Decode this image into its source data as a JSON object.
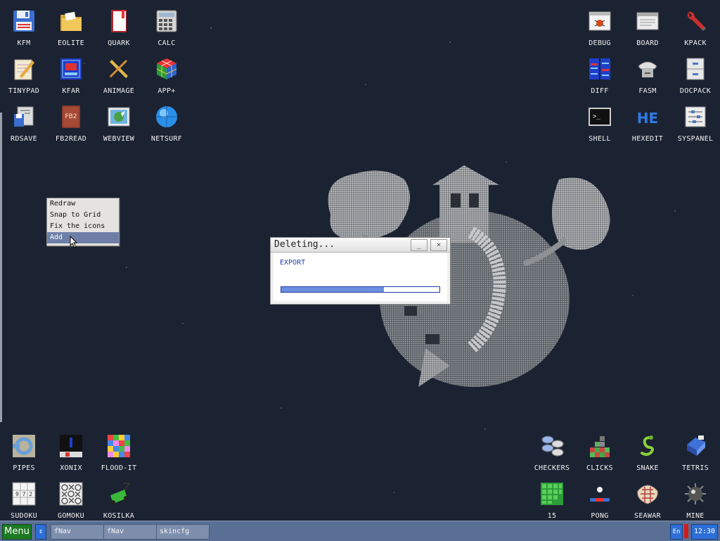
{
  "desktop": {
    "icons": {
      "kfm": "KFM",
      "eolite": "EOLITE",
      "quark": "QUARK",
      "calc": "CALC",
      "tinypad": "TINYPAD",
      "kfar": "KFAR",
      "animage": "ANIMAGE",
      "app_plus": "APP+",
      "rdsave": "RDSAVE",
      "fb2read": "FB2READ",
      "webview": "WEBVIEW",
      "netsurf": "NETSURF",
      "debug": "DEBUG",
      "board": "BOARD",
      "kpack": "KPACK",
      "diff": "DIFF",
      "fasm": "FASM",
      "docpack": "DOCPACK",
      "shell": "SHELL",
      "hexedit": "HEXEDIT",
      "syspanel": "SYSPANEL",
      "pipes": "PIPES",
      "xonix": "XONIX",
      "flood_it": "FLOOD-IT",
      "sudoku": "SUDOKU",
      "gomoku": "GOMOKU",
      "kosilka": "KOSILKA",
      "checkers": "CHECKERS",
      "clicks": "CLICKS",
      "snake": "SNAKE",
      "tetris": "TETRIS",
      "fifteen": "15",
      "pong": "PONG",
      "seawar": "SEAWAR",
      "mine": "MINE"
    },
    "fb2_glyph": "FB2",
    "he_glyph": "HE",
    "shell_glyph": ">_",
    "sudoku_glyph": "9 7 2"
  },
  "context_menu": {
    "items": [
      "Redraw",
      "Snap to Grid",
      "Fix the icons",
      "Add"
    ],
    "selected": "Add"
  },
  "dialog": {
    "title": "Deleting...",
    "minimize": "_",
    "close": "×",
    "file": "EXPORT",
    "progress_percent": 65
  },
  "taskbar": {
    "menu": "Menu",
    "switch": "⇕",
    "tasks": [
      "fNav",
      "fNav",
      "skincfg"
    ],
    "lang": "En",
    "clock": "12:30"
  },
  "colors": {
    "desktop_bg": "#1b2332",
    "taskbar": "#5a6f94",
    "menu_button": "#1c7a23",
    "accent_blue": "#2d6fd6",
    "selection": "#6e7fa7"
  }
}
